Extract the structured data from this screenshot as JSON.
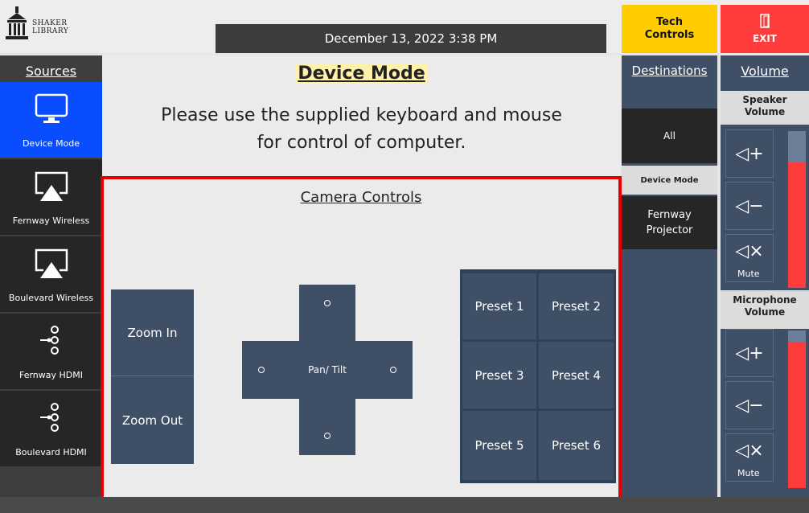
{
  "header": {
    "logo_text_line1": "SHAKER",
    "logo_text_line2": "LIBRARY",
    "datetime": "December 13, 2022 3:38 PM",
    "tech_controls_line1": "Tech",
    "tech_controls_line2": "Controls",
    "exit_label": "EXIT",
    "colors": {
      "tech": "#ffcc00",
      "exit": "#ff3b3b"
    }
  },
  "sources": {
    "heading": "Sources",
    "items": [
      {
        "label": "Device Mode",
        "icon": "monitor-icon",
        "active": true
      },
      {
        "label": "Fernway Wireless",
        "icon": "airplay-icon",
        "active": false
      },
      {
        "label": "Boulevard Wireless",
        "icon": "airplay-icon",
        "active": false
      },
      {
        "label": "Fernway HDMI",
        "icon": "hdmi-input-icon",
        "active": false
      },
      {
        "label": "Boulevard HDMI",
        "icon": "hdmi-input-icon",
        "active": false
      }
    ],
    "active_color": "#0a4dff"
  },
  "main": {
    "title": "Device Mode",
    "message": "Please use the supplied keyboard and mouse for control of computer."
  },
  "camera": {
    "title": "Camera Controls",
    "zoom_in": "Zoom In",
    "zoom_out": "Zoom Out",
    "pan_tilt": "Pan/ Tilt",
    "presets": [
      "Preset 1",
      "Preset 2",
      "Preset 3",
      "Preset 4",
      "Preset 5",
      "Preset 6"
    ]
  },
  "destinations": {
    "heading": "Destinations",
    "items": [
      {
        "label": "All",
        "selected": false
      },
      {
        "label": "Device Mode",
        "selected": true
      },
      {
        "label": "Fernway Projector",
        "selected": false
      }
    ]
  },
  "volume": {
    "heading": "Volume",
    "speaker": {
      "label": "Speaker Volume",
      "mute": "Mute",
      "level": 0.8
    },
    "microphone": {
      "label": "Microphone Volume",
      "mute": "Mute",
      "level": 0.93
    }
  }
}
